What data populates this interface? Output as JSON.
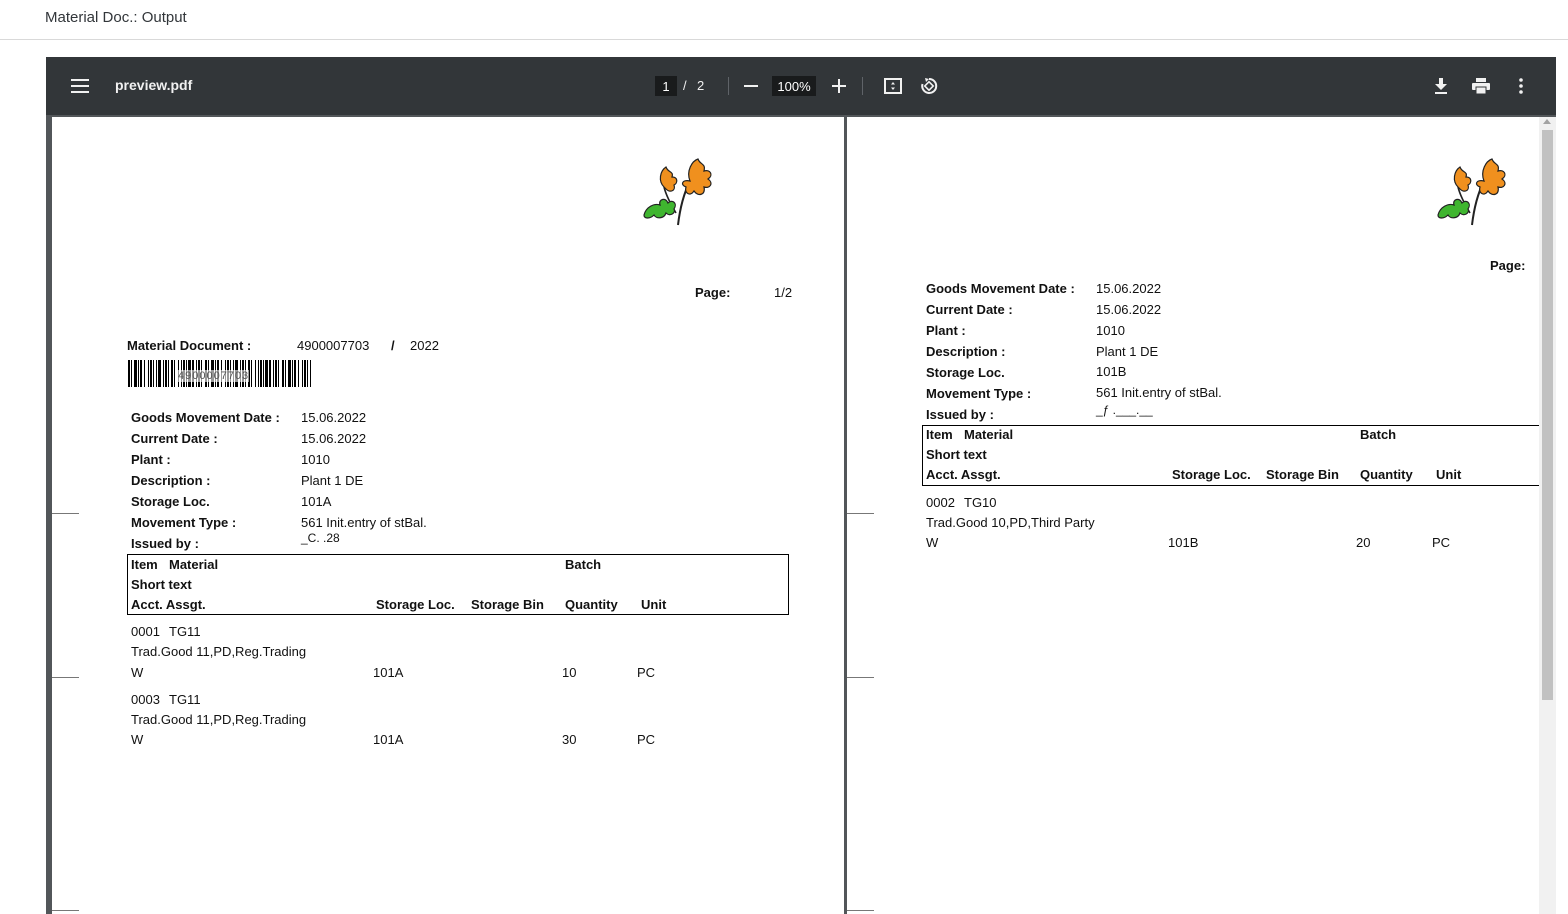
{
  "app": {
    "title": "Material Doc.: Output"
  },
  "viewer": {
    "file_name": "preview.pdf",
    "current_page": "1",
    "page_separator": "/",
    "total_pages": "2",
    "zoom": "100%",
    "icons": [
      "menu-icon",
      "minus-icon",
      "plus-icon",
      "fit-page-icon",
      "rotate-icon",
      "download-icon",
      "print-icon",
      "more-vert-icon"
    ]
  },
  "page1": {
    "page_label": "Page:",
    "page_value": "1/2",
    "material_document_label": "Material Document :",
    "material_document_number": "4900007703",
    "material_document_sep": "/",
    "material_document_year": "2022",
    "barcode_text": "4900007703",
    "fields": [
      {
        "label": "Goods Movement Date :",
        "value": "15.06.2022"
      },
      {
        "label": "Current Date :",
        "value": "15.06.2022"
      },
      {
        "label": "Plant :",
        "value": "1010"
      },
      {
        "label": "Description :",
        "value": "Plant 1 DE"
      },
      {
        "label": "Storage Loc.",
        "value": "101A"
      },
      {
        "label": "Movement Type :",
        "value": "561 Init.entry of stBal."
      },
      {
        "label": "Issued by :",
        "value": "_C.      .28"
      }
    ],
    "table_header": {
      "item": "Item",
      "material": "Material",
      "batch": "Batch",
      "short_text": "Short text",
      "acct": "Acct. Assgt.",
      "storage_loc": "Storage Loc.",
      "storage_bin": "Storage Bin",
      "quantity": "Quantity",
      "unit": "Unit"
    },
    "items": [
      {
        "item": "0001",
        "material": "TG11",
        "short_text": "Trad.Good 11,PD,Reg.Trading",
        "acct": "W",
        "storage_loc": "101A",
        "quantity": "10",
        "unit": "PC"
      },
      {
        "item": "0003",
        "material": "TG11",
        "short_text": "Trad.Good 11,PD,Reg.Trading",
        "acct": "W",
        "storage_loc": "101A",
        "quantity": "30",
        "unit": "PC"
      }
    ]
  },
  "page2": {
    "page_label": "Page:",
    "fields": [
      {
        "label": "Goods Movement Date :",
        "value": "15.06.2022"
      },
      {
        "label": "Current Date :",
        "value": "15.06.2022"
      },
      {
        "label": "Plant :",
        "value": "1010"
      },
      {
        "label": "Description :",
        "value": "Plant 1 DE"
      },
      {
        "label": "Storage Loc.",
        "value": "101B"
      },
      {
        "label": "Movement Type :",
        "value": "561 Init.entry of stBal."
      },
      {
        "label": "Issued by :",
        "value": "_ƒ  .___.__"
      }
    ],
    "table_header": {
      "item": "Item",
      "material": "Material",
      "batch": "Batch",
      "short_text": "Short text",
      "acct": "Acct. Assgt.",
      "storage_loc": "Storage Loc.",
      "storage_bin": "Storage Bin",
      "quantity": "Quantity",
      "unit": "Unit"
    },
    "items": [
      {
        "item": "0002",
        "material": "TG10",
        "short_text": "Trad.Good 10,PD,Third Party",
        "acct": "W",
        "storage_loc": "101B",
        "quantity": "20",
        "unit": "PC"
      }
    ]
  },
  "colors": {
    "toolbar": "#323639",
    "viewer_bg": "#525659",
    "leaf_orange": "#f0901e",
    "leaf_green": "#3fb52f"
  }
}
